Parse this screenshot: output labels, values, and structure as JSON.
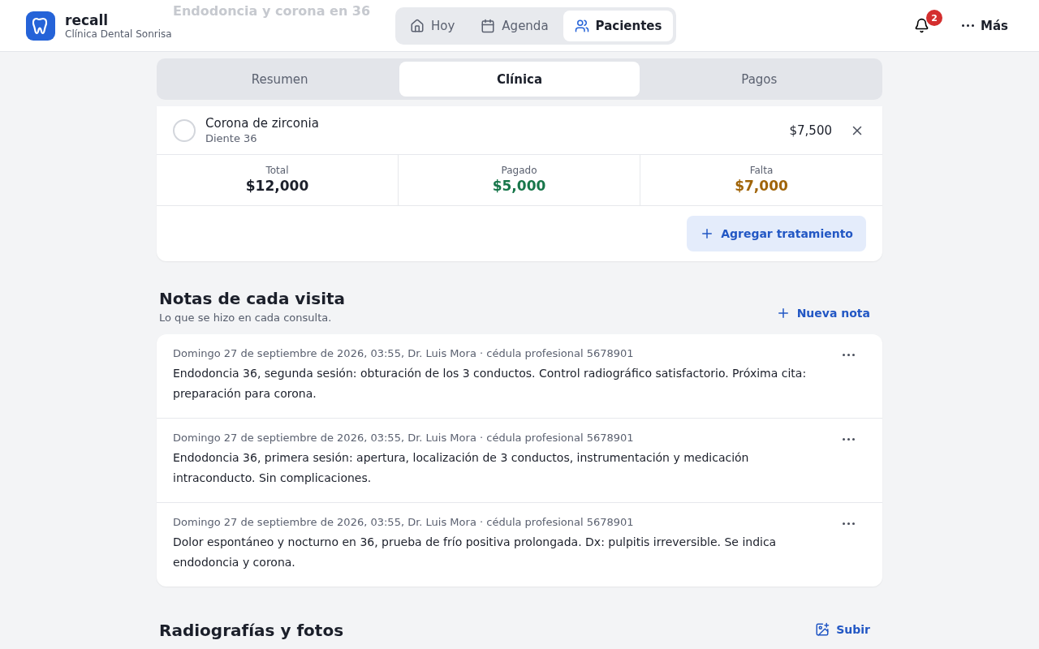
{
  "app": {
    "name": "recall",
    "clinic": "Clínica Dental Sonrisa"
  },
  "nav": [
    {
      "label": "Hoy",
      "selected": false
    },
    {
      "label": "Agenda",
      "selected": false
    },
    {
      "label": "Pacientes",
      "selected": true
    }
  ],
  "notifications": {
    "count": "2"
  },
  "more": {
    "label": "Más"
  },
  "behind_header": {
    "title": "Endodoncia y corona en 36"
  },
  "tabs": [
    {
      "label": "Resumen",
      "selected": false
    },
    {
      "label": "Clínica",
      "selected": true
    },
    {
      "label": "Pagos",
      "selected": false
    }
  ],
  "treatment": {
    "name": "Corona de zirconia",
    "tooth": "Diente 36",
    "price": "$7,500",
    "done": false
  },
  "totals": [
    {
      "label": "Total",
      "value": "$12,000",
      "color": "#1b1f2a"
    },
    {
      "label": "Pagado",
      "value": "$5,000",
      "color": "#17764a"
    },
    {
      "label": "Falta",
      "value": "$7,000",
      "color": "#a06408"
    }
  ],
  "add_treatment": "Agregar tratamiento",
  "notes_section": {
    "title": "Notas de cada visita",
    "subtitle": "Lo que se hizo en cada consulta.",
    "action": "Nueva nota"
  },
  "notes": [
    {
      "meta": "Domingo 27 de septiembre de 2026, 03:55, Dr. Luis Mora · cédula profesional 5678901",
      "text": "Endodoncia 36, segunda sesión: obturación de los 3 conductos. Control radiográfico satisfactorio. Próxima cita: preparación para corona."
    },
    {
      "meta": "Domingo 27 de septiembre de 2026, 03:55, Dr. Luis Mora · cédula profesional 5678901",
      "text": "Endodoncia 36, primera sesión: apertura, localización de 3 conductos, instrumentación y medicación intraconducto. Sin complicaciones."
    },
    {
      "meta": "Domingo 27 de septiembre de 2026, 03:55, Dr. Luis Mora · cédula profesional 5678901",
      "text": "Dolor espontáneo y nocturno en 36, prueba de frío positiva prolongada. Dx: pulpitis irreversible. Se indica endodoncia y corona."
    }
  ],
  "media_section": {
    "title": "Radiografías y fotos",
    "action": "Subir"
  }
}
